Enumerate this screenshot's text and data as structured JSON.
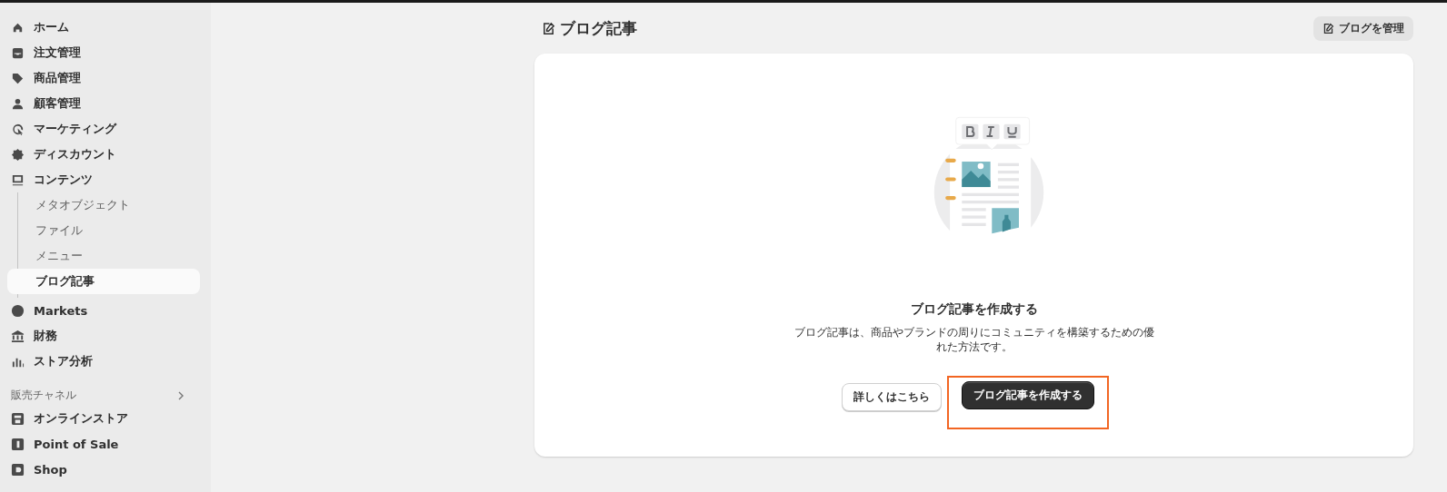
{
  "sidebar": {
    "items": [
      {
        "label": "ホーム",
        "selected": false
      },
      {
        "label": "注文管理",
        "selected": false
      },
      {
        "label": "商品管理",
        "selected": false
      },
      {
        "label": "顧客管理",
        "selected": false
      },
      {
        "label": "マーケティング",
        "selected": false
      },
      {
        "label": "ディスカウント",
        "selected": false
      },
      {
        "label": "コンテンツ",
        "selected": false,
        "expanded": true,
        "children": [
          {
            "label": "メタオブジェクト",
            "selected": false
          },
          {
            "label": "ファイル",
            "selected": false
          },
          {
            "label": "メニュー",
            "selected": false
          },
          {
            "label": "ブログ記事",
            "selected": true
          }
        ]
      },
      {
        "label": "Markets",
        "selected": false
      },
      {
        "label": "財務",
        "selected": false
      },
      {
        "label": "ストア分析",
        "selected": false
      }
    ],
    "section": {
      "title": "販売チャネル",
      "items": [
        {
          "label": "オンラインストア"
        },
        {
          "label": "Point of Sale"
        },
        {
          "label": "Shop"
        }
      ]
    }
  },
  "page": {
    "title": "ブログ記事",
    "manage_button": "ブログを管理",
    "empty_state": {
      "heading": "ブログ記事を作成する",
      "description": "ブログ記事は、商品やブランドの周りにコミュニティを構築するための優れた方法です。",
      "actions": [
        {
          "label": "詳しくはこちら",
          "kind": "secondary",
          "highlighted": false
        },
        {
          "label": "ブログ記事を作成する",
          "kind": "primary",
          "highlighted": true
        }
      ]
    }
  }
}
